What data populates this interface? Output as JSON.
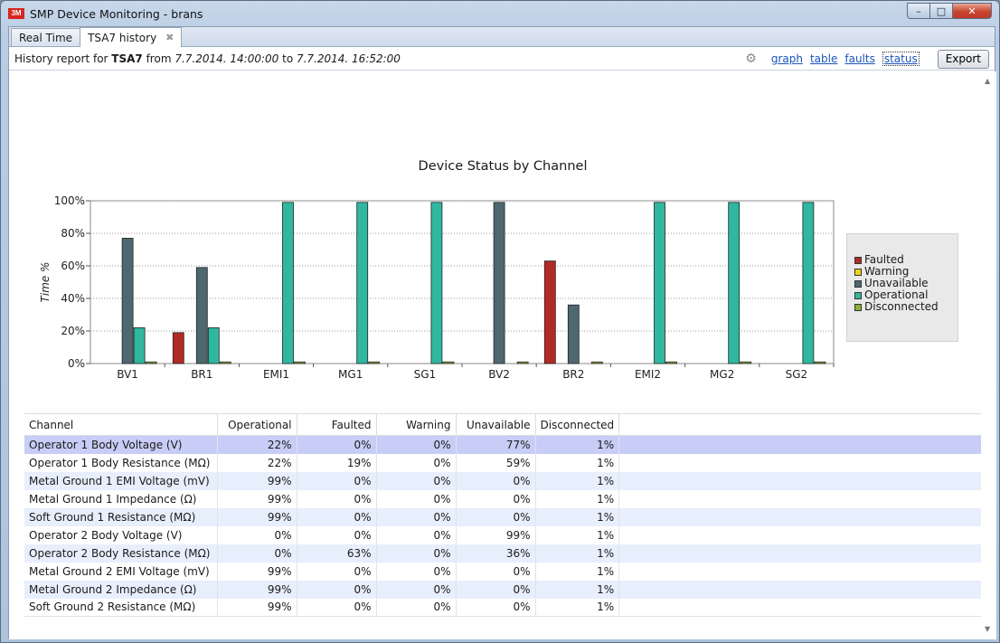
{
  "window": {
    "title": "SMP Device Monitoring - brans",
    "app_icon": "3M",
    "controls": {
      "minimize": "–",
      "maximize": "□",
      "close": "✕"
    }
  },
  "tabs": [
    {
      "label": "Real Time"
    },
    {
      "label": "TSA7 history",
      "close": "✖"
    }
  ],
  "header": {
    "prefix": "History report for ",
    "device": "TSA7",
    "from_word": " from ",
    "from": "7.7.2014. 14:00:00",
    "to_word": " to ",
    "to": "7.7.2014. 16:52:00",
    "gear_icon": "⚙",
    "links": {
      "graph": "graph",
      "table": "table",
      "faults": "faults",
      "status": "status"
    },
    "export_label": "Export"
  },
  "chart_data": {
    "type": "bar",
    "title": "Device Status by Channel",
    "xlabel": "",
    "ylabel": "Time %",
    "ylim": [
      0,
      100
    ],
    "yticks": [
      "0%",
      "20%",
      "40%",
      "60%",
      "80%",
      "100%"
    ],
    "grid": true,
    "legend_position": "right",
    "categories": [
      "BV1",
      "BR1",
      "EMI1",
      "MG1",
      "SG1",
      "BV2",
      "BR2",
      "EMI2",
      "MG2",
      "SG2"
    ],
    "series": [
      {
        "name": "Faulted",
        "color": "#b22a26",
        "values": [
          0,
          19,
          0,
          0,
          0,
          0,
          63,
          0,
          0,
          0
        ]
      },
      {
        "name": "Warning",
        "color": "#f0d11c",
        "values": [
          0,
          0,
          0,
          0,
          0,
          0,
          0,
          0,
          0,
          0
        ]
      },
      {
        "name": "Unavailable",
        "color": "#4e6870",
        "values": [
          77,
          59,
          0,
          0,
          0,
          99,
          36,
          0,
          0,
          0
        ]
      },
      {
        "name": "Operational",
        "color": "#2fb7a0",
        "values": [
          22,
          22,
          99,
          99,
          99,
          0,
          0,
          99,
          99,
          99
        ]
      },
      {
        "name": "Disconnected",
        "color": "#8db13a",
        "values": [
          1,
          1,
          1,
          1,
          1,
          1,
          1,
          1,
          1,
          1
        ]
      }
    ]
  },
  "table": {
    "columns": [
      "Channel",
      "Operational",
      "Faulted",
      "Warning",
      "Unavailable",
      "Disconnected"
    ],
    "rows": [
      [
        "Operator 1 Body Voltage (V)",
        "22%",
        "0%",
        "0%",
        "77%",
        "1%"
      ],
      [
        "Operator 1 Body Resistance (MΩ)",
        "22%",
        "19%",
        "0%",
        "59%",
        "1%"
      ],
      [
        "Metal Ground 1 EMI Voltage (mV)",
        "99%",
        "0%",
        "0%",
        "0%",
        "1%"
      ],
      [
        "Metal Ground 1 Impedance (Ω)",
        "99%",
        "0%",
        "0%",
        "0%",
        "1%"
      ],
      [
        "Soft Ground 1 Resistance (MΩ)",
        "99%",
        "0%",
        "0%",
        "0%",
        "1%"
      ],
      [
        "Operator 2 Body Voltage (V)",
        "0%",
        "0%",
        "0%",
        "99%",
        "1%"
      ],
      [
        "Operator 2 Body Resistance (MΩ)",
        "0%",
        "63%",
        "0%",
        "36%",
        "1%"
      ],
      [
        "Metal Ground 2 EMI Voltage (mV)",
        "99%",
        "0%",
        "0%",
        "0%",
        "1%"
      ],
      [
        "Metal Ground 2 Impedance (Ω)",
        "99%",
        "0%",
        "0%",
        "0%",
        "1%"
      ],
      [
        "Soft Ground 2 Resistance (MΩ)",
        "99%",
        "0%",
        "0%",
        "0%",
        "1%"
      ]
    ],
    "selected_row": 0
  }
}
